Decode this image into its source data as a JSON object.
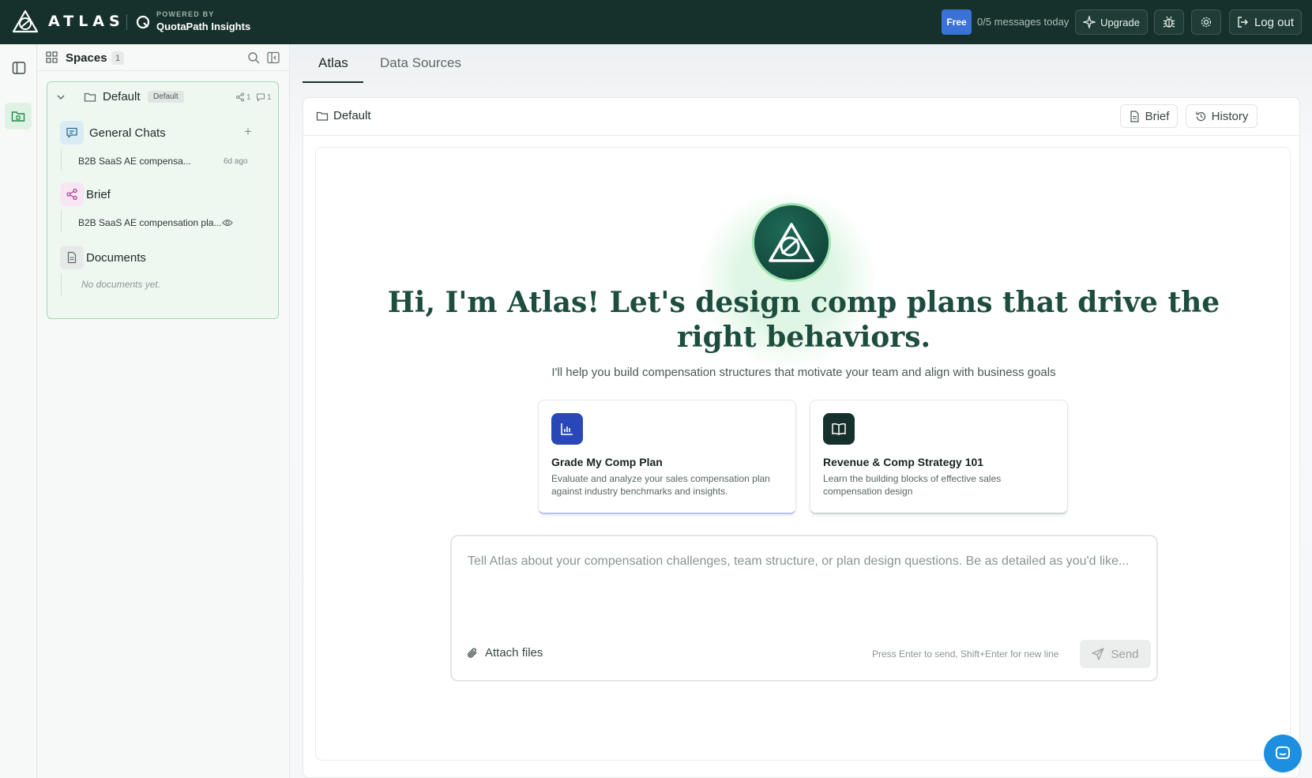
{
  "header": {
    "brand": "ATLAS",
    "powered_by": "POWERED BY",
    "partner": "QuotaPath Insights",
    "plan_badge": "Free",
    "message_quota": "0/5 messages today",
    "upgrade_label": "Upgrade",
    "logout_label": "Log out"
  },
  "sidebar": {
    "title": "Spaces",
    "count": "1",
    "space": {
      "name": "Default",
      "badge": "Default",
      "share_count": "1",
      "comment_count": "1",
      "sections": {
        "general_chats": {
          "label": "General Chats",
          "items": [
            {
              "title": "B2B SaaS AE compensa...",
              "time": "6d ago"
            }
          ]
        },
        "brief": {
          "label": "Brief",
          "items": [
            {
              "title": "B2B SaaS AE compensation pla..."
            }
          ]
        },
        "documents": {
          "label": "Documents",
          "empty": "No documents yet."
        }
      }
    }
  },
  "main": {
    "tabs": [
      {
        "label": "Atlas",
        "active": true
      },
      {
        "label": "Data Sources",
        "active": false
      }
    ],
    "panel": {
      "title": "Default",
      "brief_label": "Brief",
      "history_label": "History"
    },
    "hero": {
      "title": "Hi, I'm Atlas! Let's design comp plans that drive the right behaviors.",
      "subtitle": "I'll help you build compensation structures that motivate your team and align with business goals"
    },
    "cards": [
      {
        "icon": "bar-chart-icon",
        "title": "Grade My Comp Plan",
        "description": "Evaluate and analyze your sales compensation plan against industry benchmarks and insights.",
        "color": "#2a47b8"
      },
      {
        "icon": "book-icon",
        "title": "Revenue & Comp Strategy 101",
        "description": "Learn the building blocks of effective sales compensation design",
        "color": "#16312b"
      }
    ],
    "composer": {
      "placeholder": "Tell Atlas about your compensation challenges, team structure, or plan design questions. Be as detailed as you'd like...",
      "attach_label": "Attach files",
      "hint": "Press Enter to send, Shift+Enter for new line",
      "send_label": "Send"
    }
  },
  "colors": {
    "topbar": "#16312b",
    "accent_green": "#9edcb3",
    "free_badge": "#3a72d8",
    "help_fab": "#1d8fe0"
  }
}
